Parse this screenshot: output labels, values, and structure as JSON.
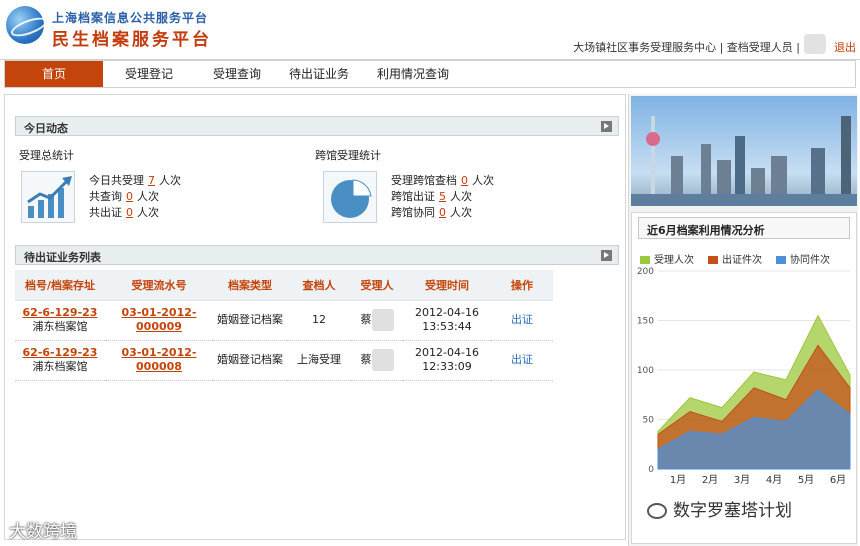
{
  "header": {
    "logo_line1": "上海档案信息公共服务平台",
    "logo_line2": "民生档案服务平台",
    "user_info": "大场镇社区事务受理服务中心 | 查档受理人员 |",
    "logout": "退出"
  },
  "nav": [
    "首页",
    "受理登记",
    "受理查询",
    "待出证业务",
    "利用情况查询"
  ],
  "today": {
    "section_title": "今日动态",
    "accept_stats": {
      "title": "受理总统计",
      "lines": [
        {
          "label": "今日共受理",
          "value": "7",
          "unit": "人次"
        },
        {
          "label": "共查询",
          "value": "0",
          "unit": "人次"
        },
        {
          "label": "共出证",
          "value": "0",
          "unit": "人次"
        }
      ]
    },
    "cross_stats": {
      "title": "跨馆受理统计",
      "lines": [
        {
          "label": "受理跨馆查档",
          "value": "0",
          "unit": "人次"
        },
        {
          "label": "跨馆出证",
          "value": "5",
          "unit": "人次"
        },
        {
          "label": "跨馆协同",
          "value": "0",
          "unit": "人次"
        }
      ]
    }
  },
  "pending": {
    "section_title": "待出证业务列表",
    "columns": [
      "档号/档案存址",
      "受理流水号",
      "档案类型",
      "查档人",
      "受理人",
      "受理时间",
      "操作"
    ],
    "rows": [
      {
        "doc_no": "62-6-129-23",
        "location": "浦东档案馆",
        "serial": "03-01-2012-000009",
        "type": "婚姻登记档案",
        "requester": "12",
        "handler_initial": "蔡",
        "date": "2012-04-16",
        "time": "13:53:44",
        "action": "出证"
      },
      {
        "doc_no": "62-6-129-23",
        "location": "浦东档案馆",
        "serial": "03-01-2012-000008",
        "type": "婚姻登记档案",
        "requester": "上海受理",
        "handler_initial": "蔡",
        "date": "2012-04-16",
        "time": "12:33:09",
        "action": "出证"
      }
    ]
  },
  "sidebar": {
    "chart_title": "近6月档案利用情况分析"
  },
  "chart_data": {
    "type": "area",
    "categories": [
      "1月",
      "2月",
      "3月",
      "4月",
      "5月",
      "6月"
    ],
    "ylim": [
      0,
      200
    ],
    "yticks": [
      0,
      50,
      100,
      150,
      200
    ],
    "grid": true,
    "legend_position": "top",
    "series": [
      {
        "name": "受理人次",
        "color": "#9cc83c",
        "values": [
          38,
          72,
          62,
          98,
          90,
          155,
          95
        ]
      },
      {
        "name": "出证件次",
        "color": "#c4501a",
        "values": [
          35,
          58,
          48,
          82,
          70,
          125,
          82
        ]
      },
      {
        "name": "协同件次",
        "color": "#4d8fd9",
        "values": [
          20,
          38,
          35,
          52,
          48,
          80,
          55
        ]
      }
    ]
  },
  "watermarks": {
    "left": "大数跨境",
    "right": "数字罗塞塔计划"
  }
}
